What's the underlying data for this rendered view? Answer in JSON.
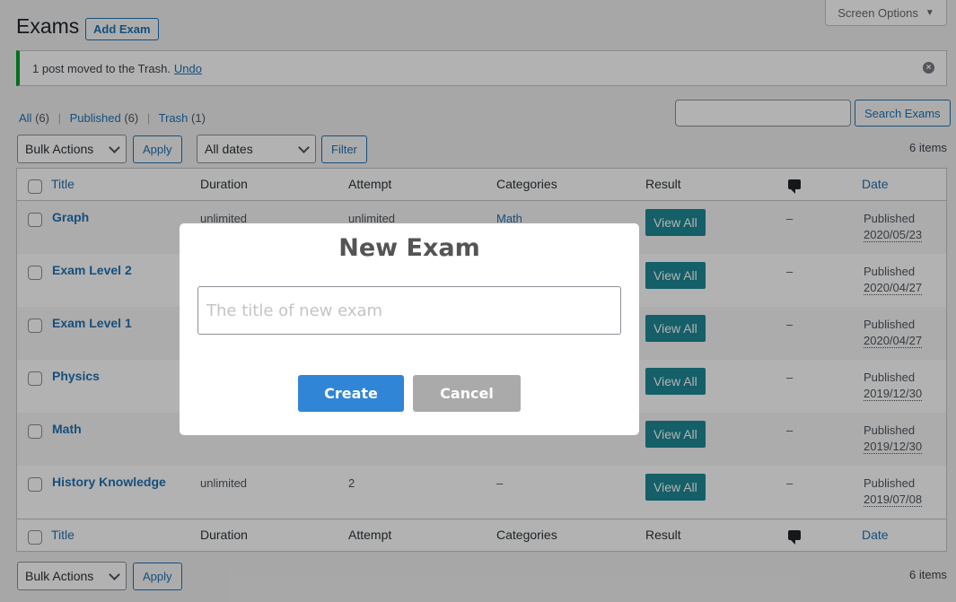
{
  "header": {
    "title": "Exams",
    "add_label": "Add Exam",
    "screen_options": "Screen Options"
  },
  "notice": {
    "text": "1 post moved to the Trash.",
    "undo": "Undo"
  },
  "filters": {
    "all": "All",
    "all_count": "(6)",
    "published": "Published",
    "published_count": "(6)",
    "trash": "Trash",
    "trash_count": "(1)"
  },
  "search": {
    "button": "Search Exams",
    "value": ""
  },
  "toolbar": {
    "bulk_actions": "Bulk Actions",
    "apply": "Apply",
    "all_dates": "All dates",
    "filter": "Filter",
    "items_count": "6 items"
  },
  "columns": {
    "title": "Title",
    "duration": "Duration",
    "attempt": "Attempt",
    "categories": "Categories",
    "result": "Result",
    "date": "Date"
  },
  "rows": [
    {
      "title": "Graph",
      "duration": "unlimited",
      "attempt": "unlimited",
      "category": "Math",
      "result": "View All",
      "comments": "–",
      "status": "Published",
      "date": "2020/05/23"
    },
    {
      "title": "Exam Level 2",
      "duration": "",
      "attempt": "",
      "category": "",
      "result": "View All",
      "comments": "–",
      "status": "Published",
      "date": "2020/04/27"
    },
    {
      "title": "Exam Level 1",
      "duration": "",
      "attempt": "",
      "category": "",
      "result": "View All",
      "comments": "–",
      "status": "Published",
      "date": "2020/04/27"
    },
    {
      "title": "Physics",
      "duration": "",
      "attempt": "",
      "category": "",
      "result": "View All",
      "comments": "–",
      "status": "Published",
      "date": "2019/12/30"
    },
    {
      "title": "Math",
      "duration": "",
      "attempt": "",
      "category": "",
      "result": "View All",
      "comments": "–",
      "status": "Published",
      "date": "2019/12/30"
    },
    {
      "title": "History Knowledge",
      "duration": "unlimited",
      "attempt": "2",
      "category": "–",
      "result": "View All",
      "comments": "–",
      "status": "Published",
      "date": "2019/07/08"
    }
  ],
  "modal": {
    "title": "New Exam",
    "input_placeholder": "The title of new exam",
    "create": "Create",
    "cancel": "Cancel"
  },
  "colors": {
    "accent": "#2271b1",
    "view_all": "#1d8996",
    "create": "#3085d6",
    "cancel": "#aaaaaa",
    "notice_border": "#00a32a"
  }
}
